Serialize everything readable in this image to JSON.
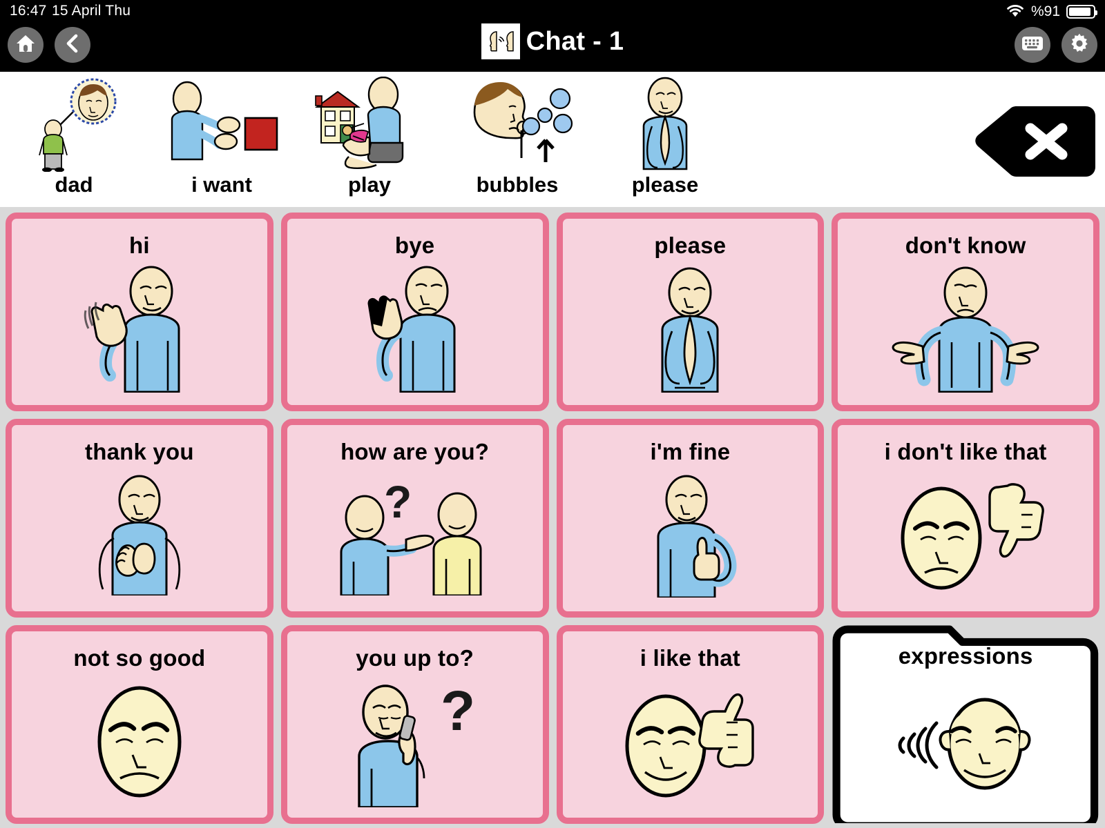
{
  "status_bar": {
    "time": "16:47",
    "date": "15 April Thu",
    "battery_percent": "%91",
    "wifi_icon": "wifi-icon",
    "battery_icon": "battery-icon"
  },
  "toolbar": {
    "home_icon": "home-icon",
    "back_icon": "back-chevron-icon",
    "keyboard_icon": "keyboard-icon",
    "settings_icon": "gear-icon",
    "title": "Chat - 1",
    "title_icon": "two-talking-heads-icon"
  },
  "sentence_bar": {
    "clear_icon": "backspace-clear-icon",
    "items": [
      {
        "label": "dad",
        "icon": "person-thought-bubble-face-icon"
      },
      {
        "label": "i want",
        "icon": "person-reaching-red-square-icon"
      },
      {
        "label": "play",
        "icon": "child-playing-dollhouse-icon"
      },
      {
        "label": "bubbles",
        "icon": "person-blowing-bubbles-icon"
      },
      {
        "label": "please",
        "icon": "person-praying-hands-icon"
      }
    ]
  },
  "board": {
    "colors": {
      "cell_fill": "#f7d3de",
      "cell_border": "#e8708f",
      "board_background": "#d9d9d9",
      "folder_fill": "#ffffff",
      "folder_border": "#000000",
      "status_bar_background": "#000000"
    },
    "cells": [
      {
        "label": "hi",
        "icon": "person-waving-hello-icon",
        "type": "word"
      },
      {
        "label": "bye",
        "icon": "person-waving-goodbye-icon",
        "type": "word"
      },
      {
        "label": "please",
        "icon": "person-praying-hands-icon",
        "type": "word"
      },
      {
        "label": "don't know",
        "icon": "person-shrugging-icon",
        "type": "word"
      },
      {
        "label": "thank you",
        "icon": "person-hands-on-heart-icon",
        "type": "word"
      },
      {
        "label": "how are you?",
        "icon": "two-people-question-mark-icon",
        "type": "word"
      },
      {
        "label": "i'm fine",
        "icon": "person-thumbs-up-chest-icon",
        "type": "word"
      },
      {
        "label": "i don't like that",
        "icon": "sad-face-thumbs-down-icon",
        "type": "word"
      },
      {
        "label": "not so good",
        "icon": "sad-face-icon",
        "type": "word"
      },
      {
        "label": "you up to?",
        "icon": "person-on-phone-question-icon",
        "type": "word"
      },
      {
        "label": "i like that",
        "icon": "happy-face-thumbs-up-icon",
        "type": "word"
      },
      {
        "label": "expressions",
        "icon": "face-with-sound-waves-icon",
        "type": "folder"
      }
    ]
  }
}
